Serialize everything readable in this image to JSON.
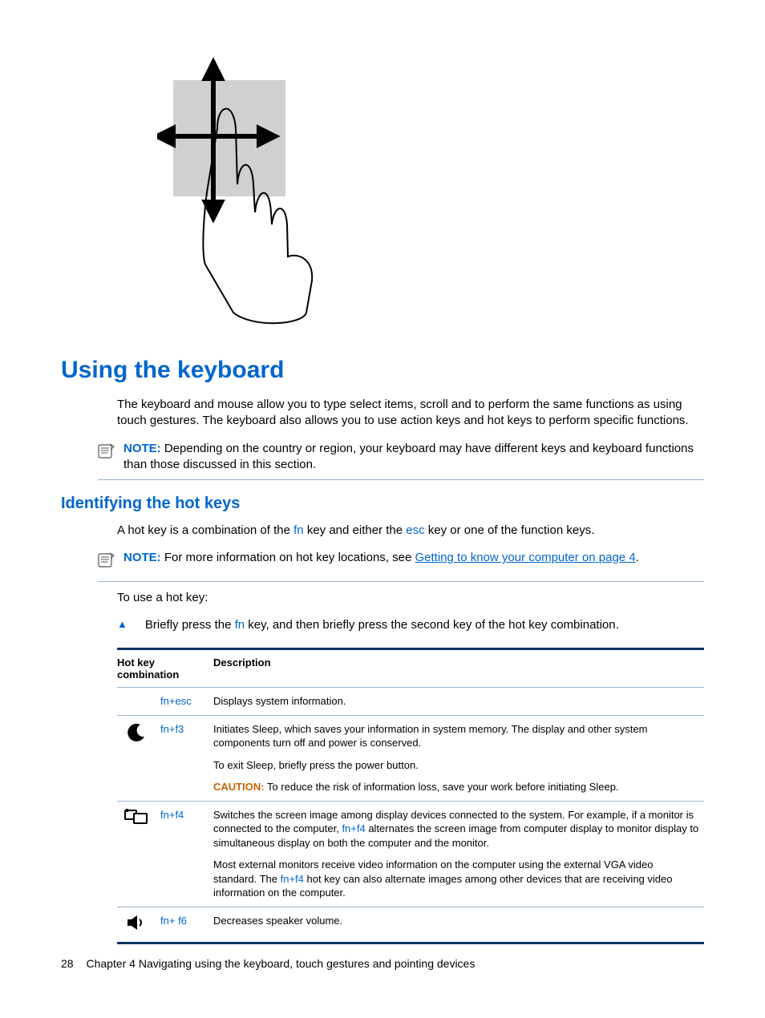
{
  "illustration_alt": "Hand touching a surface with arrows indicating movement in four directions",
  "section_heading": "Using the keyboard",
  "intro_para": "The keyboard and mouse allow you to type select items, scroll and to perform the same functions as using touch gestures. The keyboard also allows you to use action keys and hot keys to perform specific functions.",
  "note1": {
    "label": "NOTE:",
    "text": "Depending on the country or region, your keyboard may have different keys and keyboard functions than those discussed in this section."
  },
  "subsection_heading": "Identifying the hot keys",
  "hotkey_intro_prefix": "A hot key is a combination of the ",
  "hotkey_intro_key1": "fn",
  "hotkey_intro_mid": " key and either the ",
  "hotkey_intro_key2": "esc",
  "hotkey_intro_suffix": " key or one of the function keys.",
  "note2": {
    "label": "NOTE:",
    "prefix": "For more information on hot key locations, see ",
    "link": "Getting to know your computer on page 4",
    "suffix": "."
  },
  "to_use": "To use a hot key:",
  "step_prefix": "Briefly press the ",
  "step_key": "fn",
  "step_suffix": " key, and then briefly press the second key of the hot key combination.",
  "table": {
    "header_combo": "Hot key combination",
    "header_desc": "Description",
    "rows": [
      {
        "key_fn": "fn",
        "key_plus": "+",
        "key_second": "esc",
        "desc": "Displays system information."
      },
      {
        "key_fn": "fn",
        "key_plus": "+",
        "key_second": "f3",
        "p1": "Initiates Sleep, which saves your information in system memory. The display and other system components turn off and power is conserved.",
        "p2": "To exit Sleep, briefly press the power button.",
        "caution_label": "CAUTION:",
        "caution_text": "To reduce the risk of information loss, save your work before initiating Sleep."
      },
      {
        "key_fn": "fn",
        "key_plus": "+",
        "key_second": "f4",
        "p1_a": "Switches the screen image among display devices connected to the system. For example, if a monitor is connected to the computer, ",
        "p1_key_fn": "fn",
        "p1_key_plus": "+",
        "p1_key_second": "f4",
        "p1_b": " alternates the screen image from computer display to monitor display to simultaneous display on both the computer and the monitor.",
        "p2_a": "Most external monitors receive video information on the computer using the external VGA video standard. The ",
        "p2_key_fn": "fn",
        "p2_key_plus": "+",
        "p2_key_second": "f4",
        "p2_b": " hot key can also alternate images among other devices that are receiving video information on the computer."
      },
      {
        "key_fn": "fn",
        "key_plus": "+ ",
        "key_second": "f6",
        "desc": "Decreases speaker volume."
      }
    ]
  },
  "footer": {
    "page_num": "28",
    "chapter": "Chapter 4   Navigating using the keyboard, touch gestures and pointing devices"
  }
}
